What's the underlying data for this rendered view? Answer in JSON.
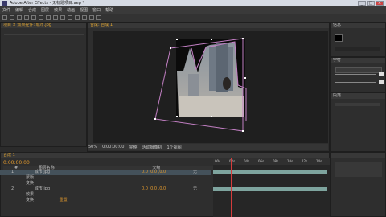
{
  "window": {
    "title": "Adobe After Effects - 无标题项目.aep *"
  },
  "menu": [
    "文件",
    "编辑",
    "合成",
    "图层",
    "效果",
    "动画",
    "视图",
    "窗口",
    "帮助"
  ],
  "project_panel": {
    "header": "项目 × 效果控件: 城市.jpg"
  },
  "viewer": {
    "header": "合成: 合成 1",
    "zoom": "50%",
    "timecode": "0:00:00:00",
    "quality": "完整",
    "camera": "活动摄像机",
    "views": "1个视图"
  },
  "right_panels": {
    "info_header": "信息",
    "character_header": "字符",
    "paragraph_header": "段落"
  },
  "timeline": {
    "tab": "合成 1",
    "timecode": "0:00:00:00",
    "columns": [
      "#",
      "图层名称",
      "父级"
    ],
    "rows": [
      {
        "num": "1",
        "name": "城市.jpg",
        "extra": "无",
        "selected": true
      },
      {
        "num": "",
        "name": "蒙版",
        "extra": "",
        "selected": false
      },
      {
        "num": "",
        "name": "变换",
        "extra": "",
        "selected": false
      },
      {
        "num": "2",
        "name": "城市.jpg",
        "extra": "无",
        "selected": false
      },
      {
        "num": "",
        "name": "效果",
        "extra": "",
        "selected": false
      },
      {
        "num": "",
        "name": "变换",
        "extra": "重置",
        "selected": false
      }
    ],
    "ruler_marks": [
      "00s",
      "02s",
      "04s",
      "06s",
      "08s",
      "10s",
      "12s",
      "14s"
    ]
  },
  "colors": {
    "mask": "#c27fc3",
    "orange": "#e39a2d",
    "playhead": "#d43c3c",
    "bar": "#7ea49e"
  }
}
